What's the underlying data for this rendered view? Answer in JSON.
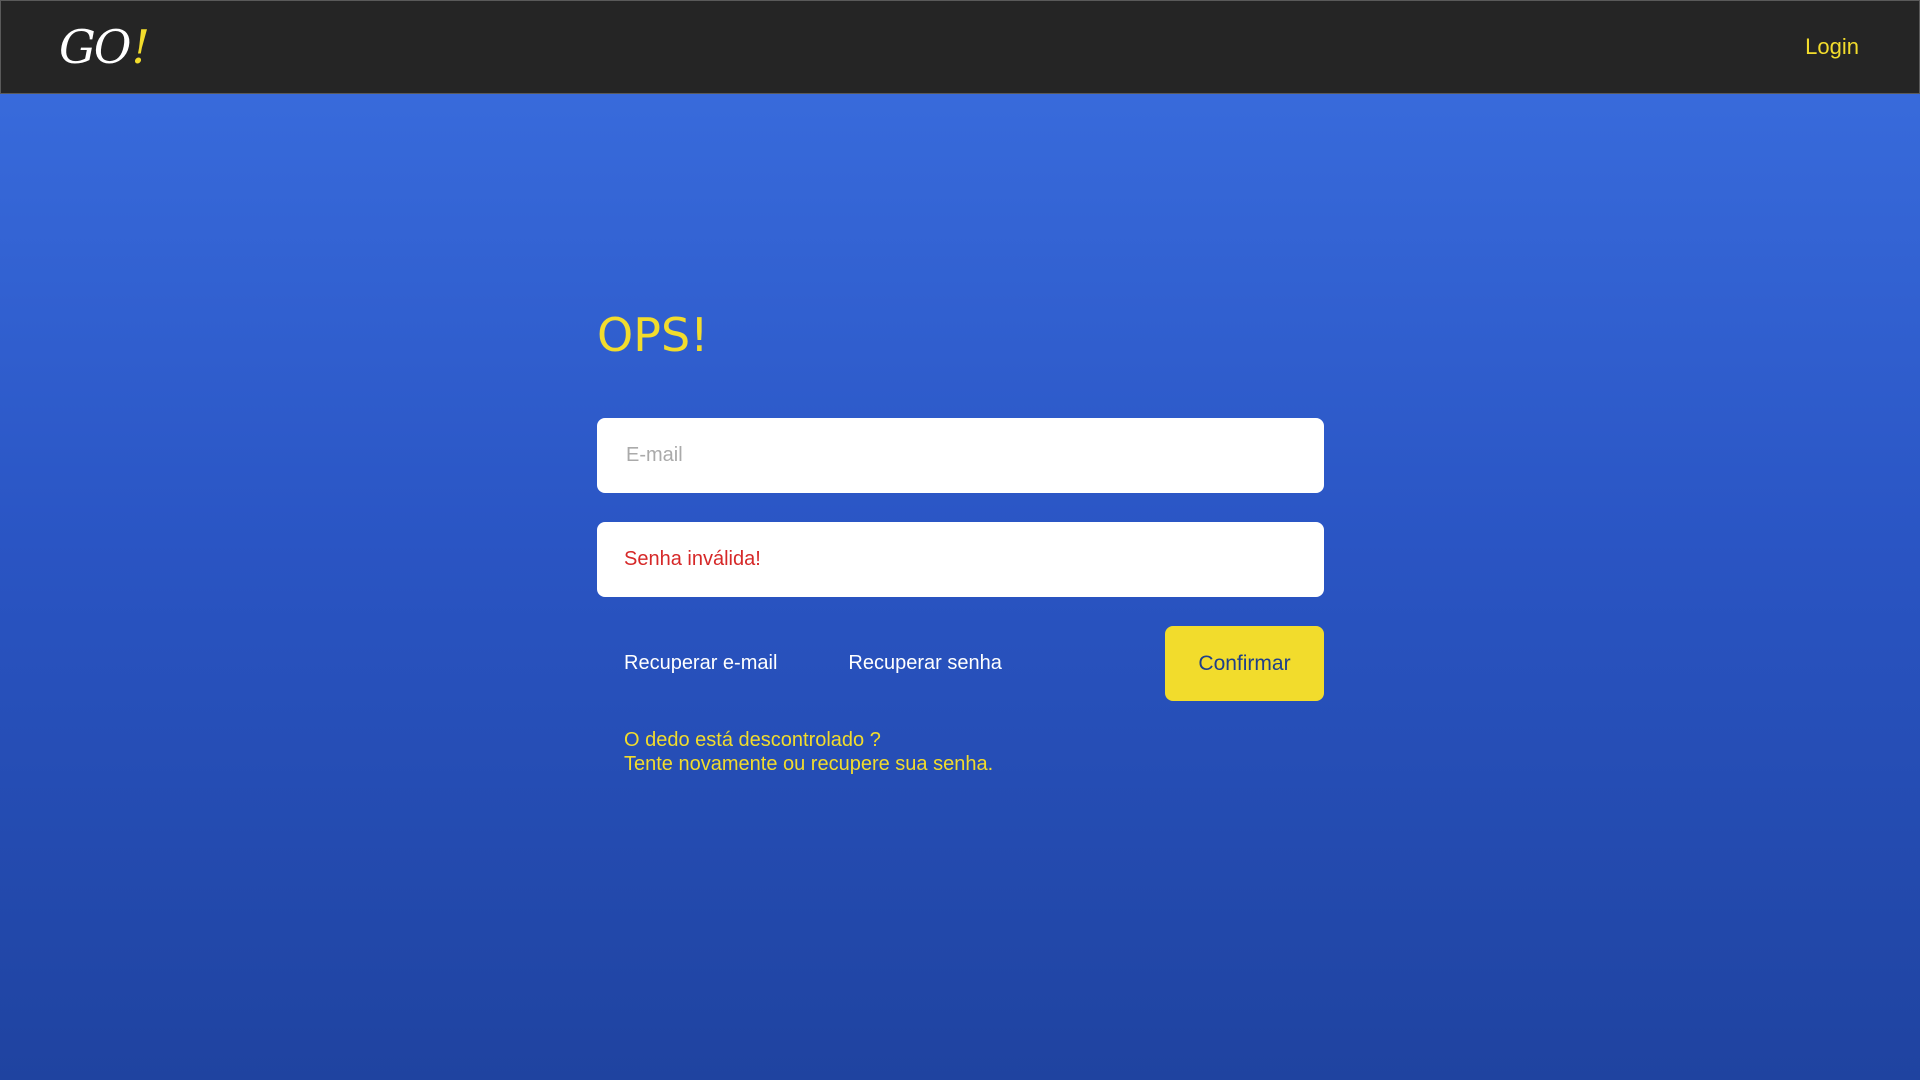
{
  "header": {
    "logo_text": "GO",
    "logo_accent": "!",
    "login_label": "Login"
  },
  "main": {
    "title": "OPS!",
    "email_placeholder": "E-mail",
    "password_error": "Senha inválida!",
    "recover_email_label": "Recuperar e-mail",
    "recover_password_label": "Recuperar senha",
    "confirm_label": "Confirmar",
    "hint_line1": "O dedo está descontrolado ?",
    "hint_line2": "Tente novamente ou recupere sua senha."
  },
  "colors": {
    "accent": "#f2dc2c",
    "header_bg": "#252525",
    "background_top": "#3b6fe0",
    "background_bottom": "#1f43a0",
    "error": "#d62828"
  }
}
